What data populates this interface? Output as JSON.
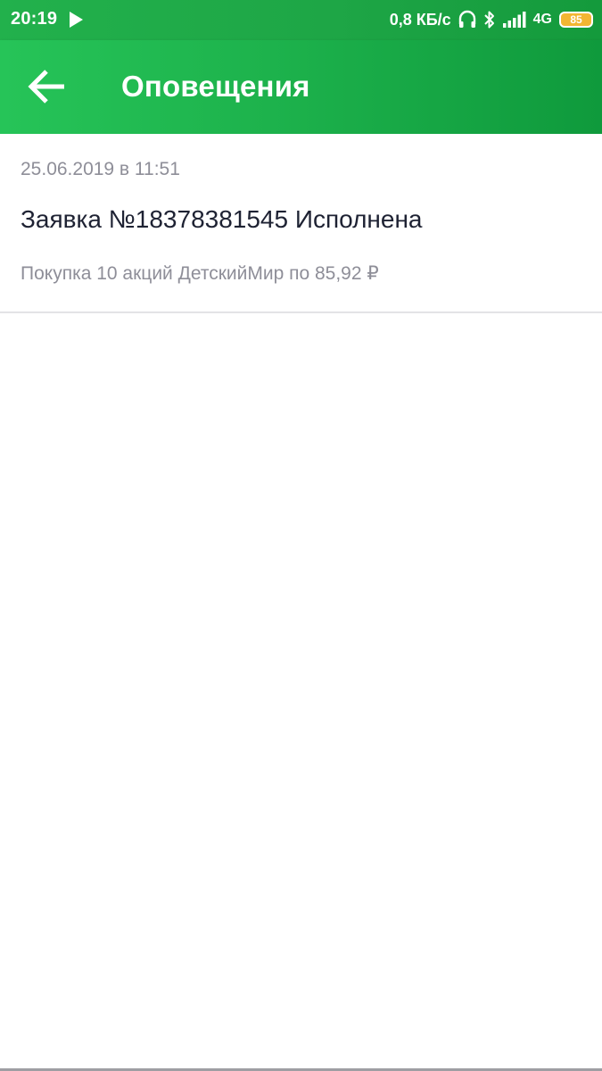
{
  "status_bar": {
    "time": "20:19",
    "net_speed": "0,8 КБ/с",
    "net_type": "4G",
    "battery": "85",
    "icons": [
      "play-icon",
      "headphones-icon",
      "bluetooth-icon",
      "signal-icon",
      "battery-icon"
    ]
  },
  "app_bar": {
    "title": "Оповещения",
    "back_icon": "arrow-back-icon"
  },
  "notifications": [
    {
      "date": "25.06.2019 в 11:51",
      "title": "Заявка №18378381545 Исполнена",
      "description": "Покупка 10 акций ДетскийМир по 85,92 ₽"
    }
  ],
  "colors": {
    "primary_green": "#1fb24c",
    "dark_green": "#0f9a3c",
    "battery_yellow": "#f2b632",
    "text_dark": "#1e2233",
    "text_muted": "#8e8e98"
  }
}
